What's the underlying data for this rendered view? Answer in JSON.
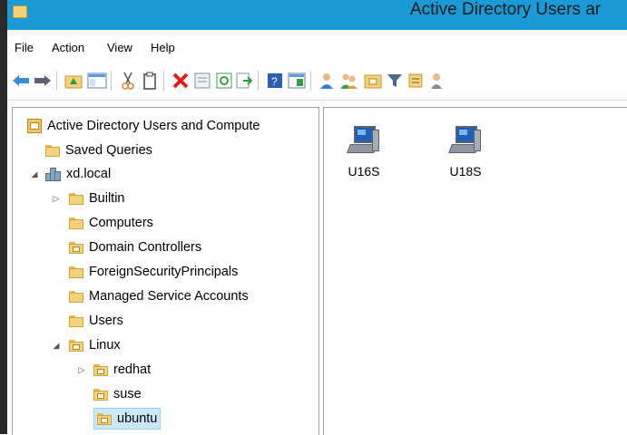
{
  "window": {
    "title": "Active Directory Users ar",
    "title_icon": "folder-icon"
  },
  "menu": {
    "items": [
      "File",
      "Action",
      "View",
      "Help"
    ]
  },
  "toolbar": {
    "buttons": [
      "back-arrow-icon",
      "forward-arrow-icon",
      "up-folder-icon",
      "show-hide-console-tree-icon",
      "cut-icon",
      "copy-icon",
      "delete-icon",
      "properties-icon",
      "refresh-icon",
      "export-list-icon",
      "help-icon",
      "view-icon",
      "new-user-icon",
      "new-group-icon",
      "new-ou-icon",
      "filter-icon",
      "find-icon",
      "add-to-group-icon"
    ]
  },
  "tree": {
    "root": "Active Directory Users and Compute",
    "saved_queries": "Saved Queries",
    "domain": "xd.local",
    "children": [
      "Builtin",
      "Computers",
      "Domain Controllers",
      "ForeignSecurityPrincipals",
      "Managed Service Accounts",
      "Users"
    ],
    "linux": "Linux",
    "linux_children": [
      "redhat",
      "suse",
      "ubuntu"
    ],
    "selected": "ubuntu"
  },
  "content": {
    "items": [
      {
        "label": "U16S",
        "icon": "computer-icon"
      },
      {
        "label": "U18S",
        "icon": "computer-icon"
      }
    ]
  },
  "colors": {
    "titlebar": "#1a9bd7",
    "selection": "#cce8ff",
    "folder": "#f2d27c"
  }
}
